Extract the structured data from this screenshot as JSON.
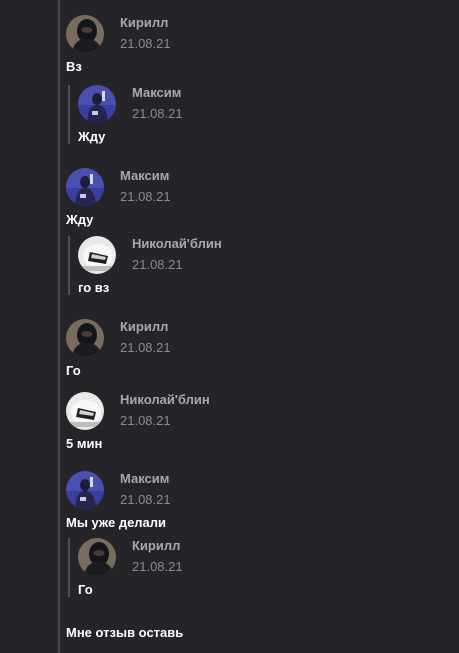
{
  "colors": {
    "background": "#252428",
    "thread_line": "#4a4950",
    "name": "#a9a8ad",
    "date": "#8b8a90",
    "text": "#ffffff"
  },
  "messages": [
    {
      "author": "Кирилл",
      "date": "21.08.21",
      "text": "Вз",
      "avatar_icon": "dark-hood-avatar-icon"
    },
    {
      "author": "Максим",
      "date": "21.08.21",
      "text": "Жду",
      "avatar_icon": "blue-figure-avatar-icon",
      "quoted": true
    },
    {
      "author": "Максим",
      "date": "21.08.21",
      "text": "Жду",
      "avatar_icon": "blue-figure-avatar-icon"
    },
    {
      "author": "Николай'блин",
      "date": "21.08.21",
      "text": "го вз",
      "avatar_icon": "white-blur-avatar-icon",
      "quoted": true
    },
    {
      "author": "Кирилл",
      "date": "21.08.21",
      "text": "Го",
      "avatar_icon": "dark-hood-avatar-icon"
    },
    {
      "author": "Николай'блин",
      "date": "21.08.21",
      "text": "5 мин",
      "avatar_icon": "white-blur-avatar-icon"
    },
    {
      "author": "Максим",
      "date": "21.08.21",
      "text": "Мы уже делали",
      "avatar_icon": "blue-figure-avatar-icon"
    },
    {
      "author": "Кирилл",
      "date": "21.08.21",
      "text": "Го",
      "avatar_icon": "dark-hood-avatar-icon",
      "quoted": true
    },
    {
      "text": "Мне отзыв оставь"
    }
  ]
}
